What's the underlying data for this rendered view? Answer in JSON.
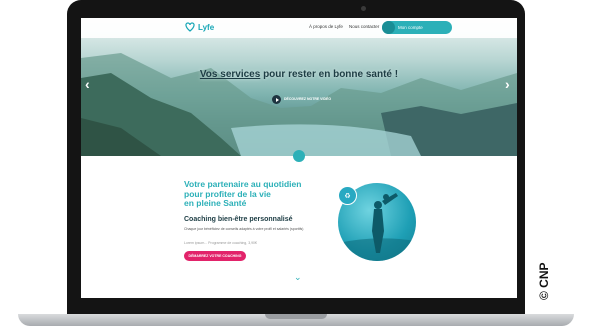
{
  "header": {
    "logo_text": "Lyfe",
    "nav": [
      {
        "label": "À propos de Lyfe"
      },
      {
        "label": "Nous contacter"
      }
    ],
    "account_label": "Mon compte"
  },
  "hero": {
    "title_prefix": "Vos services",
    "title_suffix": " pour rester en bonne santé !",
    "video_label": "DÉCOUVREZ NOTRE VIDÉO"
  },
  "content": {
    "headline": "Votre partenaire au quotidien\npour profiter de la vie\nen pleine Santé",
    "subheading": "Coaching bien-être personnalisé",
    "description": "Chaque jour bénéficiez de conseils adaptés à votre profil et salariés (sportifs)",
    "muted_line": "Lorem ipsum... Programme de coaching, 3,90€",
    "cta_label": "DÉMARREZ VOTRE COACHING"
  },
  "copyright": "© CNP",
  "colors": {
    "accent": "#2cb0b8",
    "cta": "#e2236a",
    "dark": "#1d3d44"
  }
}
